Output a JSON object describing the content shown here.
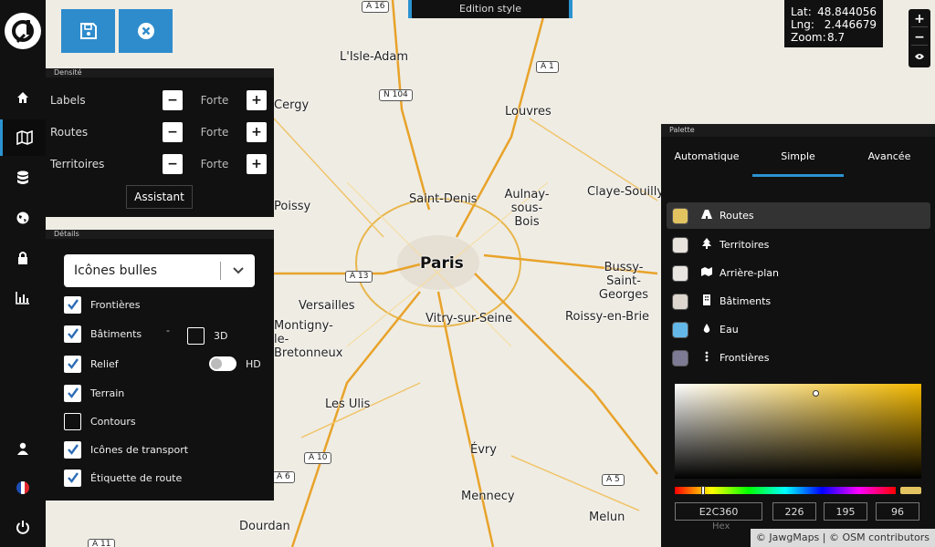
{
  "window": {
    "title": "Edition style"
  },
  "toolbar": {
    "save_label": "save",
    "cancel_label": "cancel"
  },
  "sidebar": {
    "items": [
      {
        "icon": "home-icon"
      },
      {
        "icon": "map-icon",
        "active": true
      },
      {
        "icon": "database-icon"
      },
      {
        "icon": "globe-icon"
      },
      {
        "icon": "lock-icon"
      },
      {
        "icon": "bar-chart-icon"
      },
      {
        "icon": "user-icon"
      },
      {
        "icon": "flag-fr-icon"
      },
      {
        "icon": "power-icon"
      }
    ]
  },
  "coords": {
    "lat_label": "Lat:",
    "lat": "48.844056",
    "lng_label": "Lng:",
    "lng": "2.446679",
    "zoom_label": "Zoom:",
    "zoom": "8.7"
  },
  "zoom_controls": {
    "plus": "+",
    "minus": "−"
  },
  "density": {
    "title": "Densité",
    "rows": [
      {
        "label": "Labels",
        "value": "Forte"
      },
      {
        "label": "Routes",
        "value": "Forte"
      },
      {
        "label": "Territoires",
        "value": "Forte"
      }
    ],
    "assistant": "Assistant"
  },
  "details": {
    "title": "Détails",
    "select_value": "Icônes bulles",
    "checks": [
      {
        "label": "Frontières",
        "checked": true
      },
      {
        "label": "Bâtiments",
        "checked": true
      },
      {
        "label": "Relief",
        "checked": true
      },
      {
        "label": "Terrain",
        "checked": true
      },
      {
        "label": "Contours",
        "checked": false
      },
      {
        "label": "Icônes de transport",
        "checked": true
      },
      {
        "label": "Étiquette de route",
        "checked": true
      }
    ],
    "threed_label": "3D",
    "hd_label": "HD",
    "dash": "-"
  },
  "palette": {
    "title": "Palette",
    "tabs": [
      "Automatique",
      "Simple",
      "Avancée"
    ],
    "items": [
      {
        "label": "Routes",
        "color": "#E2C360",
        "icon": "road-icon"
      },
      {
        "label": "Territoires",
        "color": "#E8E3DD",
        "icon": "tree-icon"
      },
      {
        "label": "Arrière-plan",
        "color": "#E9E6E2",
        "icon": "map-icon"
      },
      {
        "label": "Bâtiments",
        "color": "#DCD6CF",
        "icon": "building-icon"
      },
      {
        "label": "Eau",
        "color": "#63B8E8",
        "icon": "drop-icon"
      },
      {
        "label": "Frontières",
        "color": "#7D7B93",
        "icon": "dots-icon"
      }
    ],
    "hex": "E2C360",
    "r": "226",
    "g": "195",
    "b": "96",
    "hex_label": "Hex"
  },
  "map": {
    "places": [
      "L'Isle-Adam",
      "Louvres",
      "Saint-Denis",
      "Aulnay-sous-Bois",
      "Claye-Souilly",
      "Paris",
      "Versailles",
      "Vitry-sur-Seine",
      "Bussy-Saint-Georges",
      "Roissy-en-Brie",
      "Les Ulis",
      "Évry",
      "Mennecy",
      "Melun",
      "Dourdan",
      "Montigny-le-Bretonneux",
      "Poissy",
      "Cergy"
    ],
    "shields": [
      "A 16",
      "A 1",
      "N 104",
      "A 13",
      "A 10",
      "A 5",
      "A 11",
      "A 6"
    ]
  },
  "attribution": "© JawgMaps | © OSM contributors"
}
